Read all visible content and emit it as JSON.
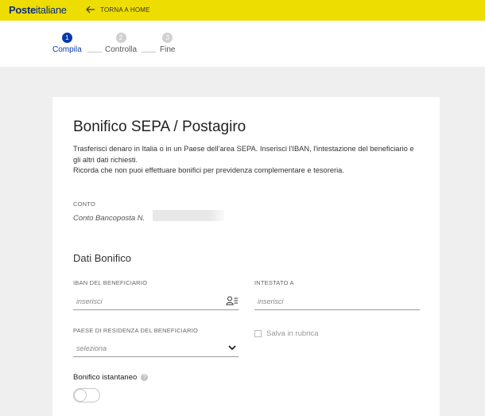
{
  "header": {
    "logo_bold": "Poste",
    "logo_regular": "italiane",
    "back_label": "TORNA A HOME",
    "bg_color": "#eedd00"
  },
  "stepper": {
    "steps": [
      {
        "num": "1",
        "label": "Compila",
        "state": "active"
      },
      {
        "num": "2",
        "label": "Controlla",
        "state": "inactive"
      },
      {
        "num": "3",
        "label": "Fine",
        "state": "inactive"
      }
    ],
    "active_color": "#0a3aa8"
  },
  "form": {
    "title": "Bonifico SEPA / Postagiro",
    "description_1": "Trasferisci denaro in Italia o in un Paese dell'area SEPA. Inserisci l'IBAN, l'intestazione del beneficiario e gli altri dati richiesti.",
    "description_2": "Ricorda che non puoi effettuare bonifici per previdenza complementare e tesoreria.",
    "conto_label": "CONTO",
    "conto_value": "Conto Bancoposta N.",
    "section_title": "Dati Bonifico",
    "iban_label": "IBAN DEL BENEFICIARIO",
    "iban_placeholder": "inserisci",
    "intestato_label": "INTESTATO A",
    "intestato_placeholder": "inserisci",
    "paese_label": "PAESE DI RESIDENZA DEL BENEFICIARIO",
    "paese_value": "seleziona",
    "rubrica_label": "Salva in rubrica",
    "istantaneo_label": "Bonifico istantaneo",
    "help_glyph": "?"
  }
}
